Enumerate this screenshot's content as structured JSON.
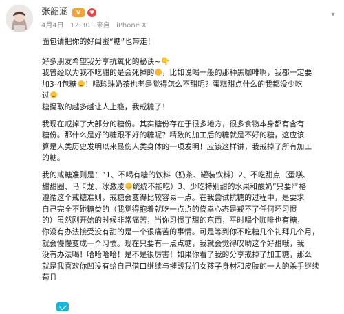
{
  "header": {
    "username": "张韶涵",
    "vip_badge": "V",
    "heart_badge": "♥",
    "date": "4月4日",
    "time": "12:30",
    "source_prefix": "来自",
    "source": "iPhone X"
  },
  "post": {
    "lines": [
      "面包请把你的好闺蜜“糖”也带走！",
      "好多朋友希望我分享抗氧化的秘诀~",
      "我曾经以为我不吃甜的是会死掉的",
      "，比如说喝一般的那种黑咖啡啊，我都一定要",
      "加3-4包糖",
      "！喝珍珠奶茶也老是觉得怎么不甜呢？蛋糕甜点什么的我都没少吃",
      "过",
      "糖摄取的越多越让人上瘾，我戒糖了！",
      "我现在戒掉了大部分的糖份。其实糖份存在于很多地方，很多食物本身都有含有",
      "糖份。那什么是好的糖跟不好的糖呢？精致的加工后的糖就是不好的糖，这应该",
      "算是人类历史发明以来最伤人类身体的一项发明！应该这样讲，我戒掉了所有加工",
      "的糖。",
      "我的戒糖准则是：“1、不喝有糖的饮料（奶茶、罐装饮料）2、不吃甜点（蛋糕、",
      "甜甜圈、马卡龙、冰激凌",
      "统统不能吃）3、少吃特别甜的水果和酸奶”只要严格",
      "遵循这个戒糖准则，戒糖会变得比较容易一点。在我尝试抗糖的过程中，是要求",
      "自己完全不碰糖类的（我觉得抱着就吃一点点的侥幸心态是戒不了任何坏习惯",
      "的）虽然刚开始的时候非常痛苦，当你习惯了甜的东西，平时喝个咖啡也有糖，",
      "你没有办法接受没有甜的是一个很痛苦的事情。可是等到你不吃糖几个礼拜几个月，",
      "就会慢慢变成一个习惯。现在只要有一点点糖，我就会觉得叹哟这个好甜哦，我",
      "没有办法喝！哈哈哈哈！是不是很厉害！如果你看了我的分享戒掉了加工糖，那么",
      "就是我喜欢你凹没有给自己借口继续与摧毁我们女孩子身材和皮肤的一大的杀手继续",
      "苟且"
    ]
  },
  "icons": {
    "hand": "pointing-down-hand-icon",
    "face": "smiley-face-icon",
    "expand": "chevron-down-icon",
    "link": "weixin-icon"
  },
  "colors": {
    "badge_vip": "#f4a23a",
    "badge_heart": "#e04848",
    "meta_text": "#8c8c8c"
  }
}
